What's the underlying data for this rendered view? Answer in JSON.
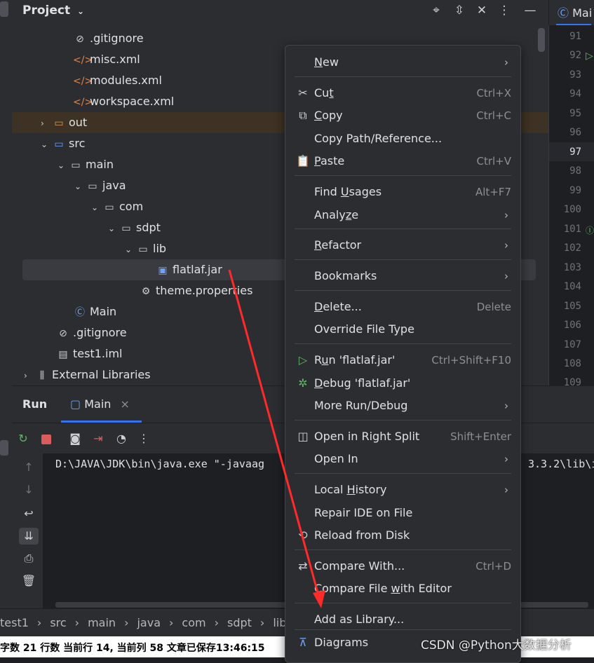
{
  "project_panel": {
    "title": "Project",
    "tree": [
      {
        "label": ".gitignore",
        "icon": "gitignore-icon"
      },
      {
        "label": "misc.xml",
        "icon": "xml-icon"
      },
      {
        "label": "modules.xml",
        "icon": "xml-icon"
      },
      {
        "label": "workspace.xml",
        "icon": "xml-icon"
      },
      {
        "label": "out",
        "icon": "folder-icon"
      },
      {
        "label": "src",
        "icon": "folder-icon"
      },
      {
        "label": "main",
        "icon": "folder-icon"
      },
      {
        "label": "java",
        "icon": "folder-icon"
      },
      {
        "label": "com",
        "icon": "package-icon"
      },
      {
        "label": "sdpt",
        "icon": "package-icon"
      },
      {
        "label": "lib",
        "icon": "package-icon"
      },
      {
        "label": "flatlaf.jar",
        "icon": "jar-icon"
      },
      {
        "label": "theme.properties",
        "icon": "properties-icon"
      },
      {
        "label": "Main",
        "icon": "class-icon"
      },
      {
        "label": ".gitignore",
        "icon": "gitignore-icon"
      },
      {
        "label": "test1.iml",
        "icon": "iml-icon"
      },
      {
        "label": "External Libraries",
        "icon": "library-icon"
      }
    ]
  },
  "editor": {
    "tab_label": "Mai",
    "line_numbers": [
      "91",
      "92",
      "93",
      "94",
      "95",
      "96",
      "97",
      "98",
      "99",
      "100",
      "101",
      "102",
      "103",
      "104",
      "105",
      "106",
      "107",
      "108",
      "109"
    ]
  },
  "run_panel": {
    "title": "Run",
    "tab_label": "Main",
    "console_text": "D:\\JAVA\\JDK\\bin\\java.exe \"-javaag",
    "console_text_right": "3.3.2\\lib\\i"
  },
  "breadcrumbs": [
    "test1",
    "src",
    "main",
    "java",
    "com",
    "sdpt",
    "lib"
  ],
  "status_bar": {
    "text": "字数  21 行数  当前行 14, 当前列 58  文章已保存13:46:15",
    "watermark": "CSDN @Python大数据分析"
  },
  "context_menu": {
    "items": [
      {
        "label": "New",
        "mnemonic_prefix": "",
        "mnemonic": "N",
        "suffix": "ew",
        "shortcut": "",
        "submenu": true
      },
      {
        "label": "Cut",
        "mnemonic_prefix": "Cu",
        "mnemonic": "t",
        "suffix": "",
        "shortcut": "Ctrl+X"
      },
      {
        "label": "Copy",
        "mnemonic_prefix": "",
        "mnemonic": "C",
        "suffix": "opy",
        "shortcut": "Ctrl+C"
      },
      {
        "label": "Copy Path/Reference...",
        "shortcut": ""
      },
      {
        "label": "Paste",
        "mnemonic_prefix": "",
        "mnemonic": "P",
        "suffix": "aste",
        "shortcut": "Ctrl+V"
      },
      {
        "label": "Find Usages",
        "mnemonic_prefix": "Find ",
        "mnemonic": "U",
        "suffix": "sages",
        "shortcut": "Alt+F7"
      },
      {
        "label": "Analyze",
        "mnemonic_prefix": "Analy",
        "mnemonic": "z",
        "suffix": "e",
        "shortcut": "",
        "submenu": true
      },
      {
        "label": "Refactor",
        "mnemonic_prefix": "",
        "mnemonic": "R",
        "suffix": "efactor",
        "shortcut": "",
        "submenu": true
      },
      {
        "label": "Bookmarks",
        "shortcut": "",
        "submenu": true
      },
      {
        "label": "Delete...",
        "mnemonic_prefix": "",
        "mnemonic": "D",
        "suffix": "elete...",
        "shortcut": "Delete"
      },
      {
        "label": "Override File Type",
        "shortcut": ""
      },
      {
        "label": "Run 'flatlaf.jar'",
        "mnemonic_prefix": "R",
        "mnemonic": "u",
        "suffix": "n 'flatlaf.jar'",
        "shortcut": "Ctrl+Shift+F10"
      },
      {
        "label": "Debug 'flatlaf.jar'",
        "mnemonic_prefix": "",
        "mnemonic": "D",
        "suffix": "ebug 'flatlaf.jar'",
        "shortcut": ""
      },
      {
        "label": "More Run/Debug",
        "shortcut": "",
        "submenu": true
      },
      {
        "label": "Open in Right Split",
        "shortcut": "Shift+Enter"
      },
      {
        "label": "Open In",
        "shortcut": "",
        "submenu": true
      },
      {
        "label": "Local History",
        "mnemonic_prefix": "Local ",
        "mnemonic": "H",
        "suffix": "istory",
        "shortcut": "",
        "submenu": true
      },
      {
        "label": "Repair IDE on File",
        "shortcut": ""
      },
      {
        "label": "Reload from Disk",
        "shortcut": ""
      },
      {
        "label": "Compare With...",
        "shortcut": "Ctrl+D"
      },
      {
        "label": "Compare File with Editor",
        "mnemonic_prefix": "Compare File ",
        "mnemonic": "w",
        "suffix": "ith Editor",
        "shortcut": ""
      },
      {
        "label": "Add as Library...",
        "shortcut": ""
      },
      {
        "label": "Diagrams",
        "shortcut": "",
        "submenu": true
      }
    ]
  },
  "colors": {
    "annotation_arrow": "#ff2a2a",
    "accent": "#3574f0",
    "run_green": "#5fb865"
  }
}
